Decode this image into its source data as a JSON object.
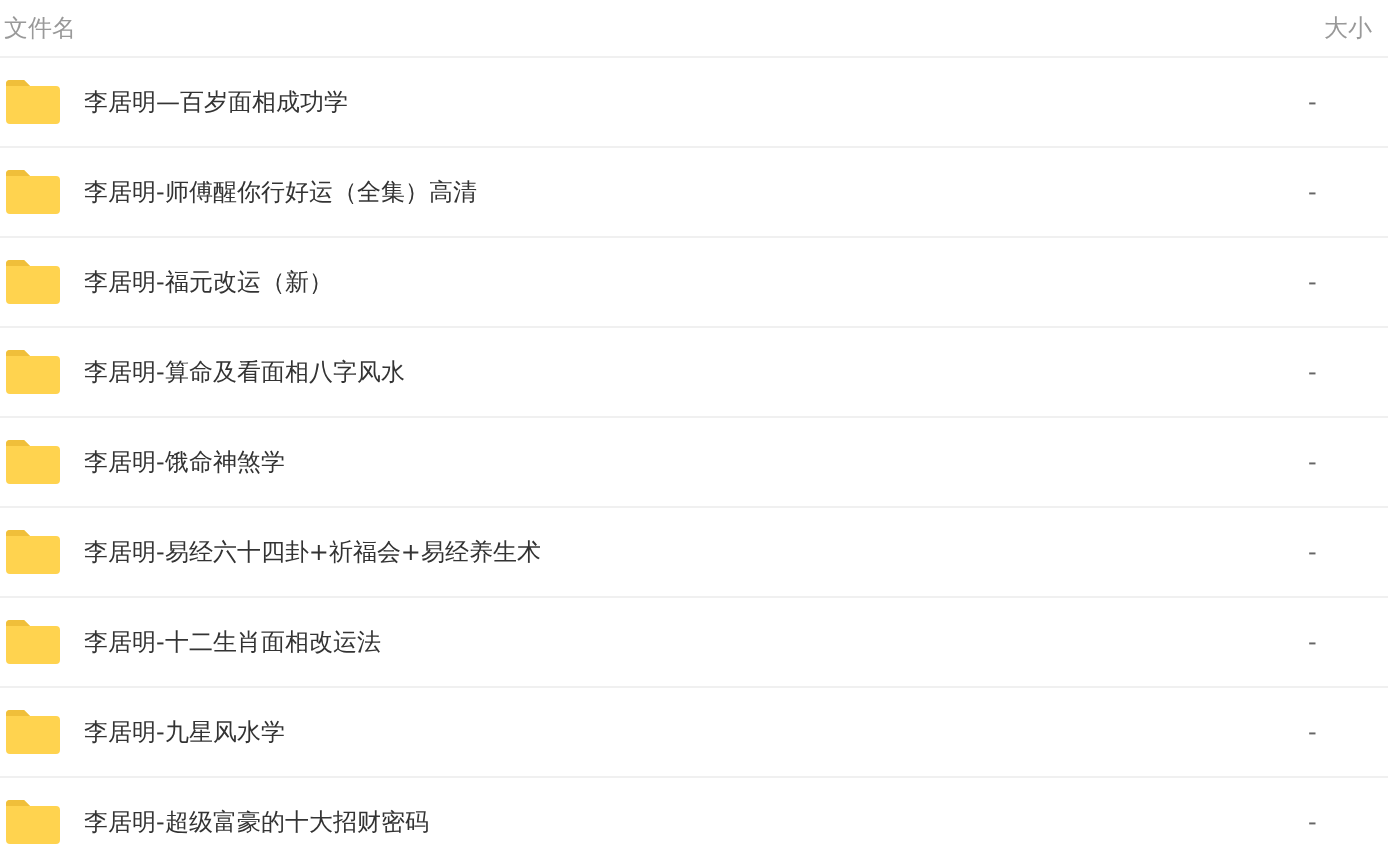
{
  "table": {
    "columns": [
      "文件名",
      "大小"
    ],
    "rows": [
      {
        "name": "李居明—百岁面相成功学",
        "size": "-"
      },
      {
        "name": "李居明-师傅醒你行好运（全集）高清",
        "size": "-"
      },
      {
        "name": "李居明-福元改运（新）",
        "size": "-"
      },
      {
        "name": "李居明-算命及看面相八字风水",
        "size": "-"
      },
      {
        "name": "李居明-饿命神煞学",
        "size": "-"
      },
      {
        "name": "李居明-易经六十四卦+祈福会+易经养生术",
        "size": "-"
      },
      {
        "name": "李居明-十二生肖面相改运法",
        "size": "-"
      },
      {
        "name": "李居明-九星风水学",
        "size": "-"
      },
      {
        "name": "李居明-超级富豪的十大招财密码",
        "size": "-"
      }
    ]
  }
}
